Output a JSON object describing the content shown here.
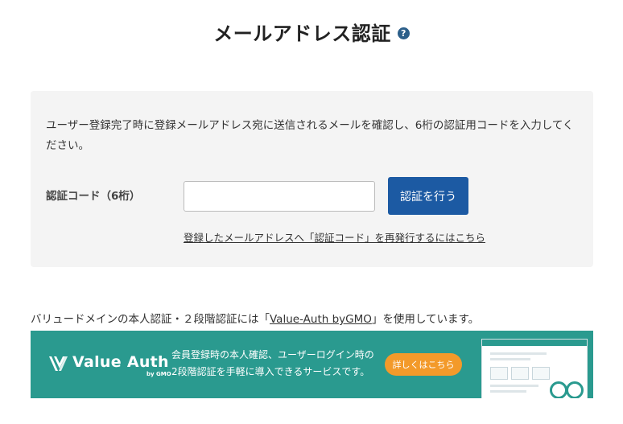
{
  "page": {
    "title": "メールアドレス認証",
    "help_icon": "question-icon"
  },
  "panel": {
    "description": "ユーザー登録完了時に登録メールアドレス宛に送信されるメールを確認し、6桁の認証用コードを入力してください。",
    "code_label": "認証コード（6桁）",
    "code_input_value": "",
    "submit_label": "認証を行う",
    "reissue_link": "登録したメールアドレスへ「認証コード」を再発行するにはこちら"
  },
  "notice": {
    "prefix": "バリュードメインの本人認証・２段階認証には「",
    "link": "Value-Auth byGMO",
    "suffix": "」を使用しています。"
  },
  "banner": {
    "logo_text": "Value Auth",
    "logo_sub": "by GMO",
    "line1": "会員登録時の本人確認、ユーザーログイン時の",
    "line2": "2段階認証を手軽に導入できるサービスです。",
    "detail_button": "詳しくはこちら",
    "colors": {
      "background": "#2a9a8f",
      "button": "#f39a2a"
    }
  },
  "colors": {
    "primary_button": "#1c5aa3",
    "panel_background": "#f4f4f4"
  }
}
